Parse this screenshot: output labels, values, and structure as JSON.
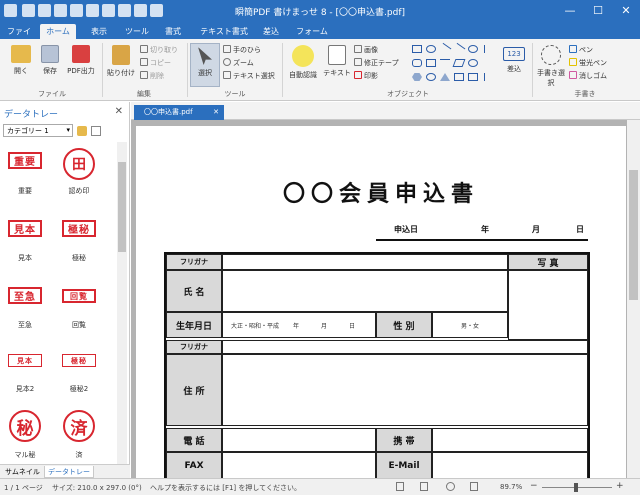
{
  "window": {
    "title": "瞬簡PDF 書けまっせ 8 - [〇〇申込書.pdf]",
    "controls": {
      "minimize": "—",
      "maximize": "☐",
      "close": "✕"
    }
  },
  "menu_tabs": [
    "ファイル",
    "ホーム",
    "表示",
    "ツール",
    "書式",
    "テキスト書式",
    "差込",
    "フォーム"
  ],
  "active_tab": "ホーム",
  "ribbon": {
    "file_group": {
      "label": "ファイル",
      "open": "開く",
      "save": "保存",
      "pdf_export": "PDF出力"
    },
    "edit_group": {
      "label": "編集",
      "paste": "貼り付け",
      "cut": "切り取り",
      "copy": "コピー",
      "delete": "削除"
    },
    "tools_group": {
      "label": "ツール",
      "select": "選択",
      "hand": "手のひら",
      "zoom": "ズーム",
      "text_select": "テキスト選択"
    },
    "object_group": {
      "label": "オブジェクト",
      "auto_detect": "自動認識",
      "text": "テキスト",
      "image": "画像",
      "correction_tape": "修正テープ",
      "seal": "印影",
      "page_num": "123",
      "insert": "差込"
    },
    "handwrite_group": {
      "label": "手書き",
      "handwrite_select": "手書き選択",
      "pen": "ペン",
      "highlighter": "蛍光ペン",
      "eraser": "消しゴム"
    }
  },
  "data_tray": {
    "title": "データトレー",
    "category": "カテゴリー 1",
    "stamps": [
      {
        "glyph": "重要",
        "label": "重要",
        "shape": "rect"
      },
      {
        "glyph": "田",
        "label": "認め印",
        "shape": "circ"
      },
      {
        "glyph": "見本",
        "label": "見本",
        "shape": "rect"
      },
      {
        "glyph": "極秘",
        "label": "極秘",
        "shape": "rect"
      },
      {
        "glyph": "至急",
        "label": "至急",
        "shape": "rect"
      },
      {
        "glyph": "回覧",
        "label": "回覧",
        "shape": "rect"
      },
      {
        "glyph": "見本",
        "label": "見本2",
        "shape": "rect"
      },
      {
        "glyph": "極秘",
        "label": "極秘2",
        "shape": "rect"
      },
      {
        "glyph": "秘",
        "label": "マル秘",
        "shape": "circ"
      },
      {
        "glyph": "済",
        "label": "済",
        "shape": "circ"
      }
    ],
    "bottom_tabs": [
      "サムネイル",
      "データトレー"
    ]
  },
  "document_tab": "〇〇申込書.pdf",
  "form": {
    "title": "〇〇会員申込書",
    "application_date": "申込日",
    "year": "年",
    "month": "月",
    "day": "日",
    "furigana": "フリガナ",
    "name": "氏 名",
    "photo": "写 真",
    "birthdate": "生年月日",
    "era": "大正・昭和・平成",
    "y": "年",
    "m": "月",
    "d": "日",
    "gender_label": "性 別",
    "gender_options": "男・女",
    "furigana2": "フリガナ",
    "address": "住 所",
    "phone": "電 話",
    "mobile": "携 帯",
    "fax": "FAX",
    "email": "E-Mail"
  },
  "status": {
    "page": "1 / 1 ページ",
    "size": "サイズ: 210.0 x 297.0 (0°)",
    "help": "ヘルプを表示するには [F1] を押してください。",
    "zoom": "89.7%"
  },
  "colors": {
    "accent": "#2b6fbe",
    "stamp_red": "#d8262f"
  }
}
